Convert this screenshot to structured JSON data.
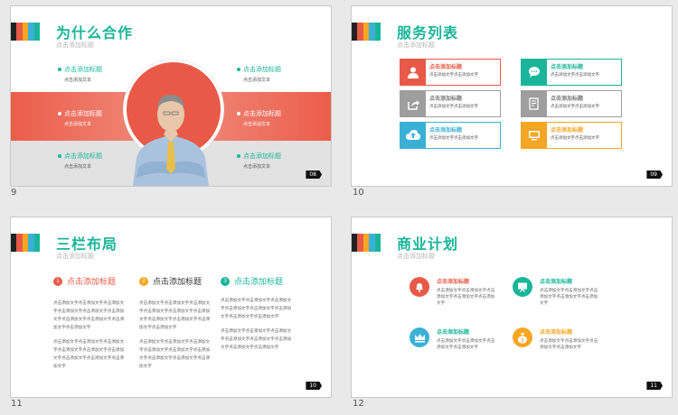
{
  "slide_numbers": [
    "9",
    "10",
    "11",
    "12"
  ],
  "colors": {
    "accent": "#19b59a",
    "red": "#e85a47",
    "gray": "#9e9e9e",
    "blue": "#3ab0d6",
    "orange": "#f5a623",
    "teal": "#19b59a"
  },
  "bar_colors": [
    "#222222",
    "#e85a47",
    "#f5a623",
    "#3ab0d6",
    "#19b59a"
  ],
  "slide9": {
    "title": "为什么合作",
    "subtitle": "点击添加标题",
    "page": "08",
    "items": [
      {
        "heading": "点击添加标题",
        "text": "点击添加文本"
      },
      {
        "heading": "点击添加标题",
        "text": "点击添加文本"
      },
      {
        "heading": "点击添加标题",
        "text": "点击添加文本"
      },
      {
        "heading": "点击添加标题",
        "text": "点击添加文本"
      },
      {
        "heading": "点击添加标题",
        "text": "点击添加文本"
      },
      {
        "heading": "点击添加标题",
        "text": "点击添加文本"
      }
    ]
  },
  "slide10": {
    "title": "服务列表",
    "subtitle": "点击添加标题",
    "page": "09",
    "items": [
      {
        "heading": "点击添加标题",
        "text": "点击添加文字点击添加文字",
        "icon": "person-icon"
      },
      {
        "heading": "点击添加标题",
        "text": "点击添加文字点击添加文字",
        "icon": "chat-icon"
      },
      {
        "heading": "点击添加标题",
        "text": "点击添加文字点击添加文字",
        "icon": "share-icon"
      },
      {
        "heading": "点击添加标题",
        "text": "点击添加文字点击添加文字",
        "icon": "document-icon"
      },
      {
        "heading": "点击添加标题",
        "text": "点击添加文字点击添加文字",
        "icon": "cloud-upload-icon"
      },
      {
        "heading": "点击添加标题",
        "text": "点击添加文字点击添加文字",
        "icon": "monitor-icon"
      }
    ]
  },
  "slide11": {
    "title": "三栏布局",
    "subtitle": "点击添加标题",
    "page": "10",
    "columns": [
      {
        "num": "1",
        "heading": "点击添加标题",
        "p1": "点击添加文字点击添加文字点击添加文字点击添加文字点击添加文字点击添加文字点击添加文字点击添加文字点击添加文字点击添加文字",
        "p2": "点击添加文字点击添加文字点击添加文字点击添加文字点击添加文字点击添加文字点击添加文字点击添加文字点击添加文字"
      },
      {
        "num": "2",
        "heading": "点击添加标题",
        "p1": "点击添加文字点击添加文字点击添加文字点击添加文字点击添加文字点击添加文字点击添加文字点击添加文字点击添加文字点击添加文字",
        "p2": "点击添加文字点击添加文字点击添加文字点击添加文字点击添加文字点击添加文字点击添加文字点击添加文字点击添加文字"
      },
      {
        "num": "3",
        "heading": "点击添加标题",
        "p1": "点击添加文字点击添加文字点击添加文字点击添加文字点击添加文字点击添加文字点击添加文字点击添加文字",
        "p2": "点击添加文字点击添加文字点击添加文字点击添加文字点击添加文字点击添加文字点击添加文字点击添加文字"
      }
    ]
  },
  "slide12": {
    "title": "商业计划",
    "subtitle": "点击添加标题",
    "page": "11",
    "items": [
      {
        "heading": "点击添加标题",
        "text": "点击添加文字点击添加文字点击添加文字点击添加文字点击添加文字",
        "icon": "bell-icon"
      },
      {
        "heading": "点击添加标题",
        "text": "点击添加文字点击添加文字点击添加文字点击添加文字点击添加文字",
        "icon": "presentation-board-icon"
      },
      {
        "heading": "点击添加标题",
        "text": "点击添加文字点击添加文字点击添加文字点击添加文字",
        "icon": "crown-icon"
      },
      {
        "heading": "点击添加标题",
        "text": "点击添加文字点击添加文字点击添加文字点击添加文字",
        "icon": "money-bag-icon"
      }
    ]
  }
}
